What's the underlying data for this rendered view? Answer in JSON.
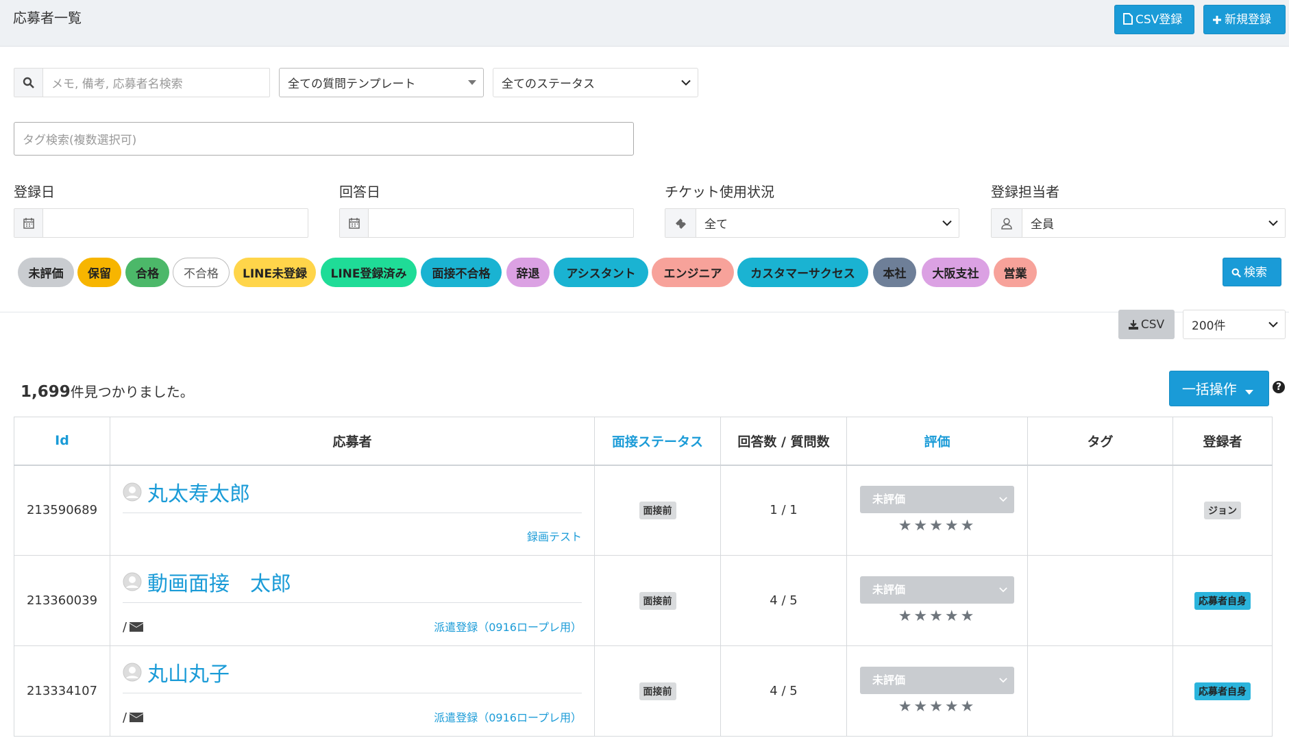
{
  "header": {
    "title": "応募者一覧",
    "csv_register_label": "CSV登録",
    "new_register_label": "新規登録"
  },
  "filters": {
    "search_placeholder": "メモ, 備考, 応募者名検索",
    "template_select": "全ての質問テンプレート",
    "status_select": "全てのステータス",
    "tag_search_placeholder": "タグ検索(複数選択可)",
    "registered_date_label": "登録日",
    "answered_date_label": "回答日",
    "ticket_label": "チケット使用状況",
    "ticket_value": "全て",
    "registrar_label": "登録担当者",
    "registrar_value": "全員"
  },
  "tags": [
    {
      "label": "未評価",
      "color": "#c9ccd0"
    },
    {
      "label": "保留",
      "color": "#f7b500"
    },
    {
      "label": "合格",
      "color": "#4cb869"
    },
    {
      "label": "不合格",
      "color": "#ffffff"
    },
    {
      "label": "LINE未登録",
      "color": "#ffd54a"
    },
    {
      "label": "LINE登録済み",
      "color": "#1fdc97"
    },
    {
      "label": "面接不合格",
      "color": "#1ab3d2"
    },
    {
      "label": "辞退",
      "color": "#dba1e3"
    },
    {
      "label": "アシスタント",
      "color": "#1ab3d2"
    },
    {
      "label": "エンジニア",
      "color": "#f7a29a"
    },
    {
      "label": "カスタマーサクセス",
      "color": "#1ab3d2"
    },
    {
      "label": "本社",
      "color": "#6e7f98"
    },
    {
      "label": "大阪支社",
      "color": "#dba1e3"
    },
    {
      "label": "営業",
      "color": "#f7a29a"
    }
  ],
  "search_button_label": "検索",
  "csv_download_label": "CSV",
  "page_size_select": "200件",
  "result": {
    "count": "1,699",
    "suffix": "件見つかりました。"
  },
  "bulk_action_label": "一括操作",
  "table": {
    "headers": {
      "id": "Id",
      "applicant": "応募者",
      "interview_status": "面接ステータス",
      "answers": "回答数 / 質問数",
      "evaluation": "評価",
      "tags": "タグ",
      "registrar": "登録者"
    },
    "rows": [
      {
        "id": "213590689",
        "name": "丸太寿太郎",
        "contact": "",
        "template": "録画テスト",
        "status": "面接前",
        "answers": "1 / 1",
        "evaluation": "未評価",
        "registrar": "ジョン"
      },
      {
        "id": "213360039",
        "name": "動画面接　太郎",
        "contact": "/",
        "template": "派遣登録（0916ロープレ用）",
        "status": "面接前",
        "answers": "4 / 5",
        "evaluation": "未評価",
        "registrar": "応募者自身"
      },
      {
        "id": "213334107",
        "name": "丸山丸子",
        "contact": "/",
        "template": "派遣登録（0916ロープレ用）",
        "status": "面接前",
        "answers": "4 / 5",
        "evaluation": "未評価",
        "registrar": "応募者自身"
      }
    ]
  },
  "colors": {
    "accent": "#1a9bd7",
    "header_bg": "#eef1f4"
  }
}
